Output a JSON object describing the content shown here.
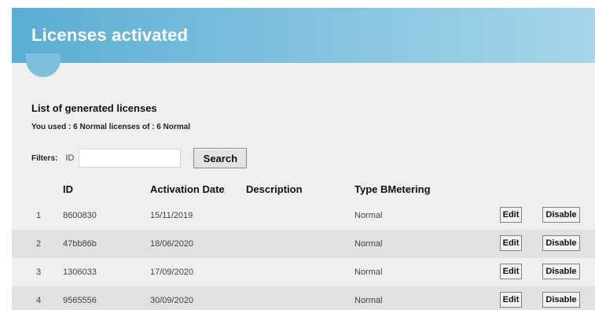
{
  "header": {
    "title": "Licenses activated"
  },
  "list": {
    "heading": "List of generated licenses",
    "usage": "You used : 6 Normal licenses of : 6 Normal"
  },
  "filters": {
    "label": "Filters:",
    "id_label": "ID",
    "id_value": "",
    "search_label": "Search"
  },
  "table": {
    "columns": [
      "ID",
      "Activation Date",
      "Description",
      "Type BMetering"
    ],
    "rows": [
      {
        "index": "1",
        "id": "8600830",
        "date": "15/11/2019",
        "description": "",
        "type": "Normal",
        "edit": "Edit",
        "disable": "Disable"
      },
      {
        "index": "2",
        "id": "47bb86b",
        "date": "18/06/2020",
        "description": "",
        "type": "Normal",
        "edit": "Edit",
        "disable": "Disable"
      },
      {
        "index": "3",
        "id": "1306033",
        "date": "17/09/2020",
        "description": "",
        "type": "Normal",
        "edit": "Edit",
        "disable": "Disable"
      },
      {
        "index": "4",
        "id": "9565556",
        "date": "30/09/2020",
        "description": "",
        "type": "Normal",
        "edit": "Edit",
        "disable": "Disable"
      }
    ]
  },
  "colors": {
    "banner_start": "#5aaed3",
    "banner_end": "#a7d5ea",
    "panel_bg": "#efefef",
    "row_alt_bg": "#e1e1e1"
  }
}
